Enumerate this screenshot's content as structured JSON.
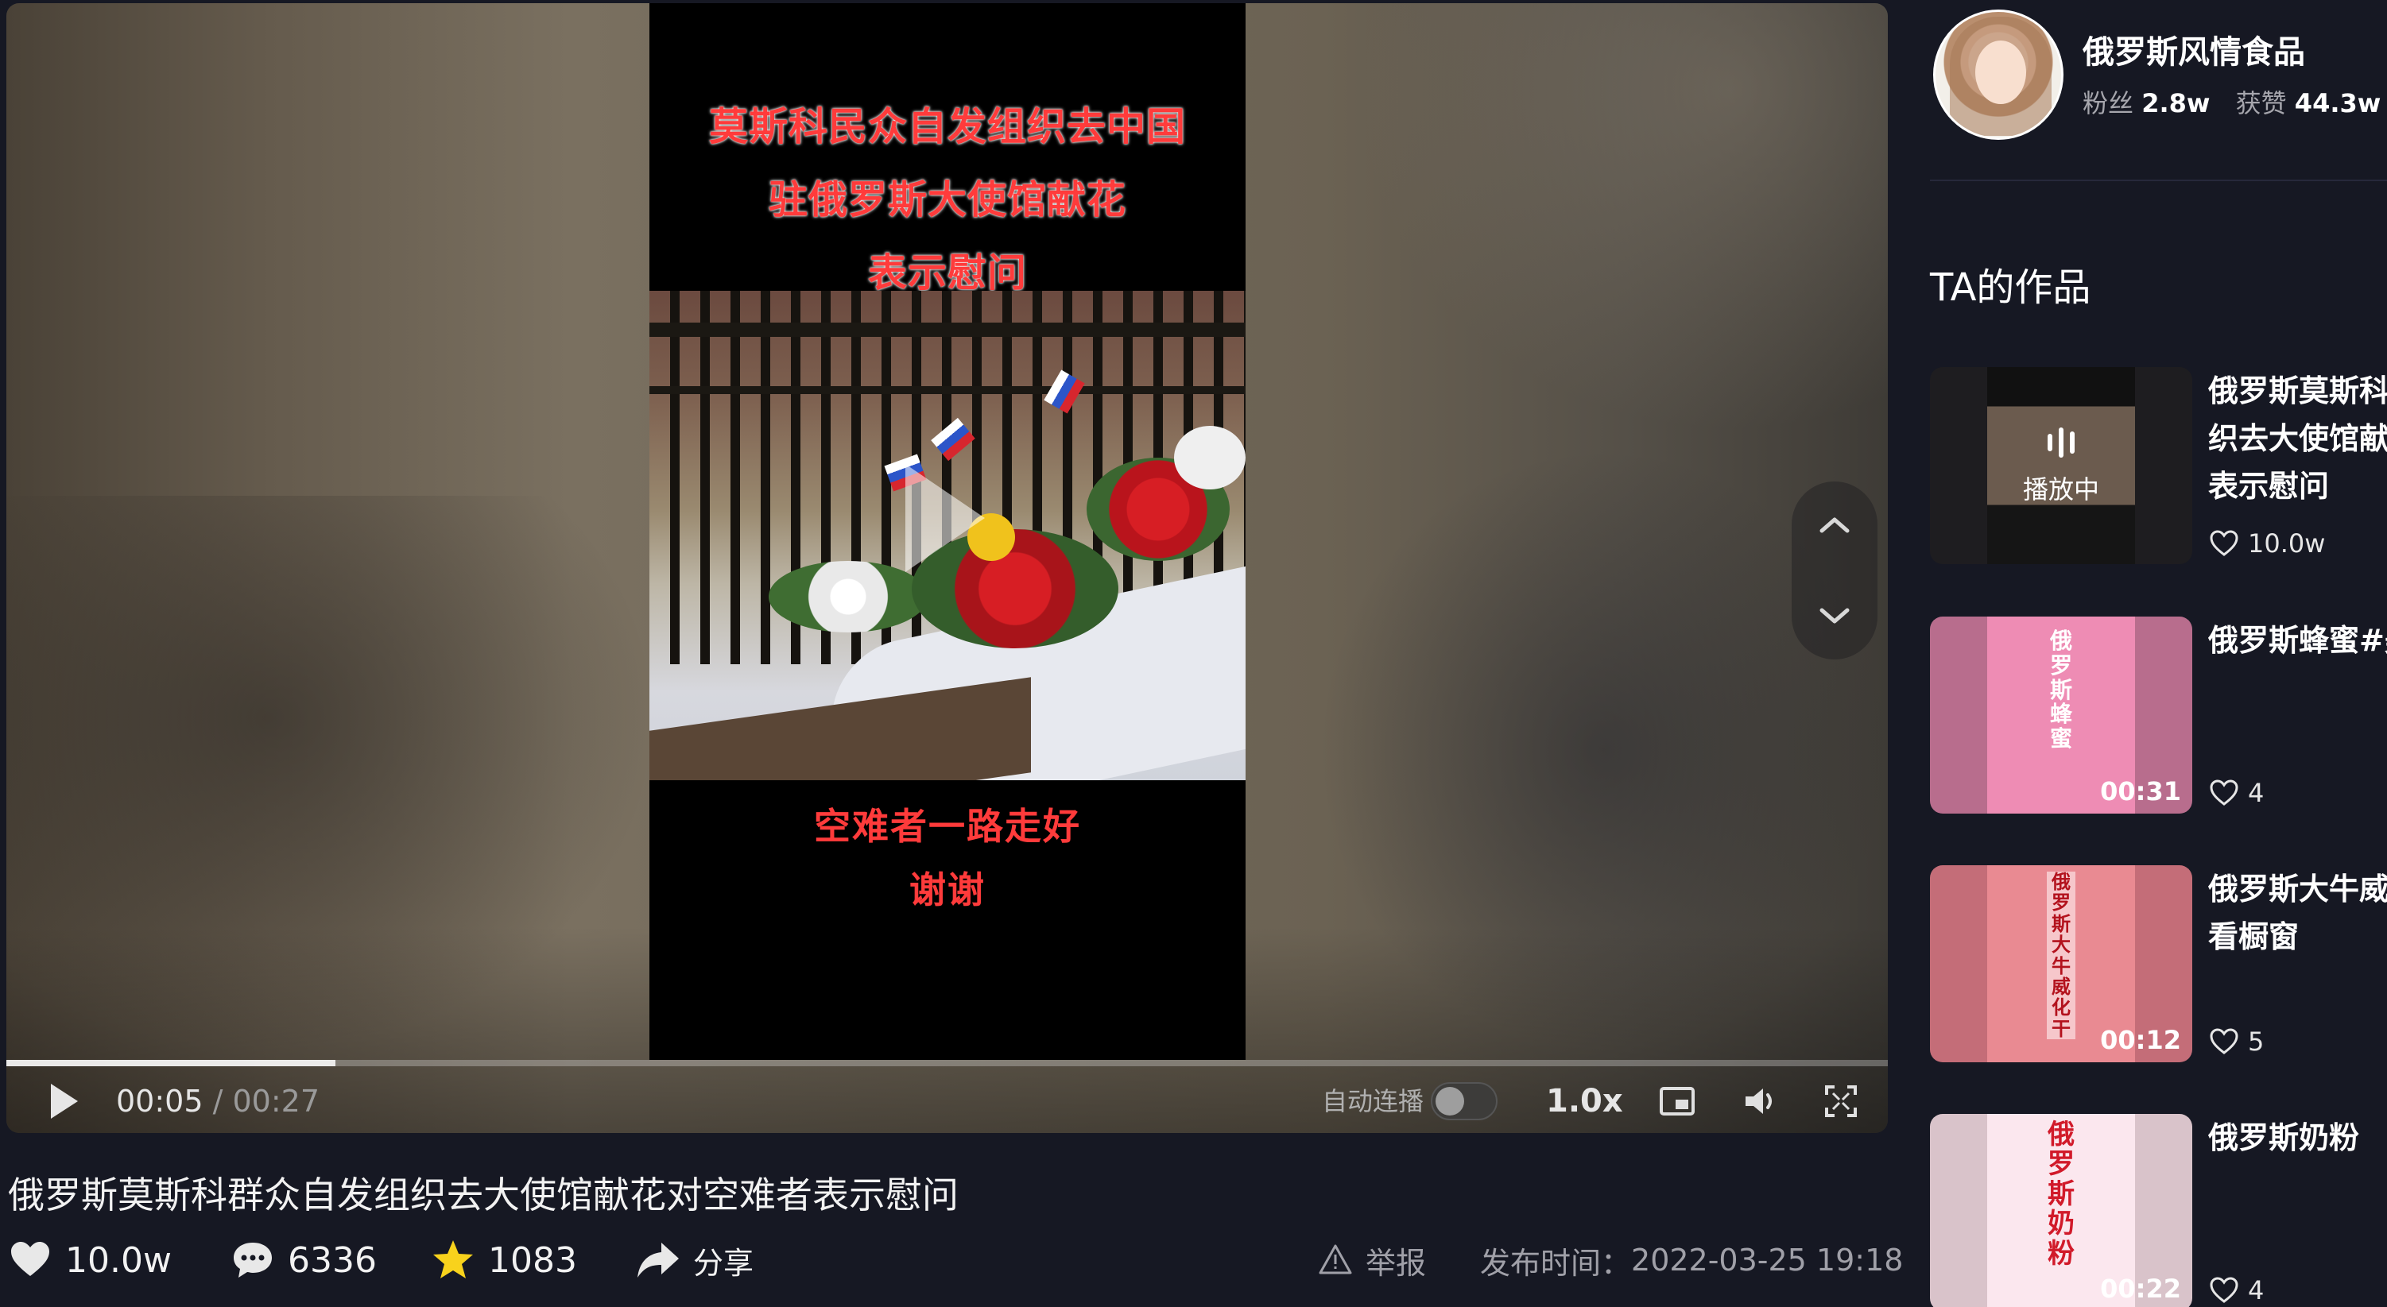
{
  "video": {
    "caption_lines": [
      "莫斯科民众自发组织去中国",
      "驻俄罗斯大使馆献花",
      "表示慰问"
    ],
    "bottom_lines": [
      "空难者一路走好",
      "谢谢"
    ],
    "progress_fraction": 0.175
  },
  "player_controls": {
    "current_time": "00:05",
    "total_time": "00:27",
    "time_separator": " / ",
    "autoplay_label": "自动连播",
    "autoplay_on": false,
    "speed": "1.0x"
  },
  "title": "俄罗斯莫斯科群众自发组织去大使馆献花对空难者表示慰问",
  "actions": {
    "likes": "10.0w",
    "comments": "6336",
    "favorites": "1083",
    "share": "分享",
    "report": "举报",
    "publish_label": "发布时间：",
    "publish_time": "2022-03-25 19:18"
  },
  "author": {
    "name": "俄罗斯风情食品",
    "fans_label": "粉丝",
    "fans": "2.8w",
    "likes_label": "获赞",
    "likes": "44.3w"
  },
  "works": {
    "heading": "TA的作品",
    "items": [
      {
        "title_lines": [
          "俄罗斯莫斯科群众自发组",
          "织去大使馆献花对空难者",
          "表示慰问"
        ],
        "likes": "10.0w",
        "status": "播放中",
        "duration": ""
      },
      {
        "title_lines": [
          "俄罗斯蜂蜜#美食"
        ],
        "likes": "4",
        "status": "",
        "duration": "00:31",
        "thumb_text": "俄罗斯蜂蜜"
      },
      {
        "title_lines": [
          "俄罗斯大牛威化饼干",
          "看橱窗"
        ],
        "likes": "5",
        "status": "",
        "duration": "00:12",
        "thumb_text": "俄罗斯大牛威化干"
      },
      {
        "title_lines": [
          "俄罗斯奶粉"
        ],
        "likes": "4",
        "status": "",
        "duration": "00:22",
        "thumb_text": "俄罗斯奶粉"
      }
    ]
  },
  "colors": {
    "background": "#161823",
    "caption_red": "#ff3b3b",
    "muted_text": "#a0a0a8"
  },
  "icons": [
    "play-icon",
    "pip-icon",
    "volume-icon",
    "fullscreen-icon",
    "chevron-up-icon",
    "chevron-down-icon",
    "heart-icon",
    "comment-icon",
    "star-icon",
    "share-icon",
    "warning-icon"
  ]
}
